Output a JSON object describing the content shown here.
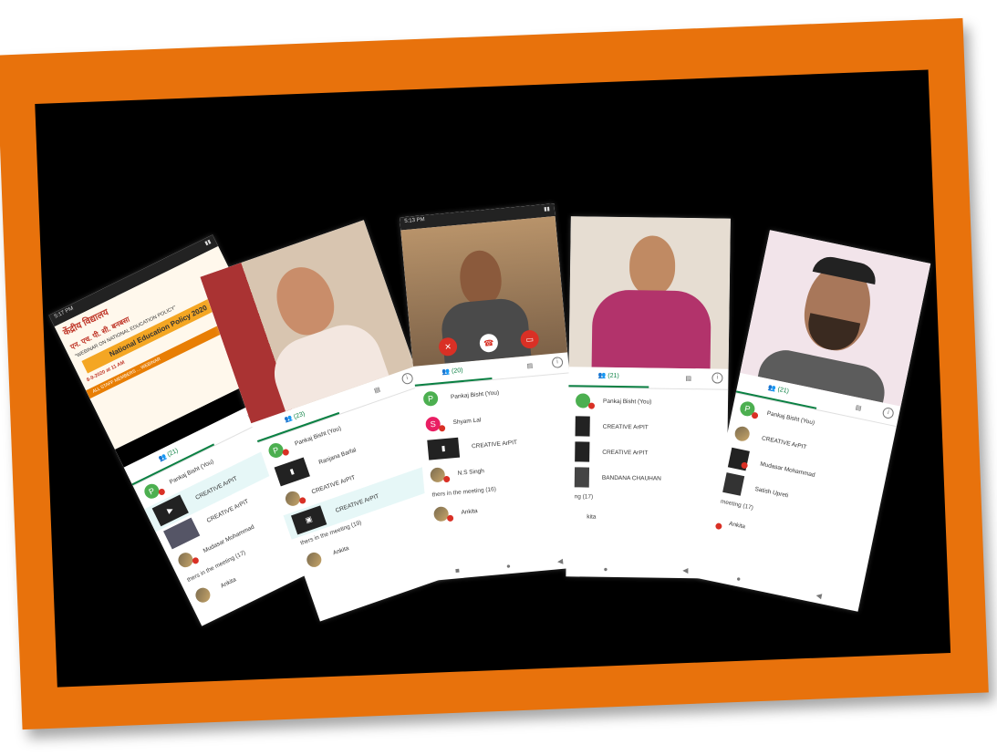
{
  "phones": [
    {
      "status_time": "5:17 PM",
      "poster": {
        "hindi_title": "केंद्रीय विद्यालय",
        "hindi_sub": "एन. एच. पी. सी. बनबसा",
        "subtitle": "\"WEBINAR ON NATIONAL EDUCATION POLICY\"",
        "banner": "National Education Policy 2020",
        "date": "8-9-2020 at 11 AM",
        "footer": "ALL STAFF MEMBERS ... WEBINAR"
      },
      "people_count": "(21)",
      "rows": [
        {
          "avatar": "P",
          "name": "Pankaj Bisht (You)"
        },
        {
          "avatar": "",
          "name": "CREATIVE ArPIT"
        },
        {
          "avatar": "",
          "name": "CREATIVE ArPIT"
        },
        {
          "avatar": "",
          "name": "Mudasar Mohammad"
        }
      ],
      "section": "thers in the meeting (17)",
      "last_row": "Ankita"
    },
    {
      "people_count": "(23)",
      "rows": [
        {
          "avatar": "P",
          "name": "Pankaj Bisht (You)"
        },
        {
          "avatar": "",
          "name": "Ranjana Barfal"
        },
        {
          "avatar": "",
          "name": "CREATIVE ArPIT"
        },
        {
          "avatar": "",
          "name": "CREATIVE ArPIT"
        }
      ],
      "section": "thers in the meeting (19)",
      "last_row": "Ankita"
    },
    {
      "status_time": "5:13 PM",
      "people_count": "(20)",
      "rows": [
        {
          "avatar": "P",
          "name": "Pankaj Bisht (You)"
        },
        {
          "avatar": "S",
          "name": "Shyam Lal"
        },
        {
          "avatar": "",
          "name": "CREATIVE ArPIT"
        },
        {
          "avatar": "",
          "name": "N.S Singh"
        }
      ],
      "section": "thers in the meeting (16)",
      "last_row": "Ankita"
    },
    {
      "people_count": "(21)",
      "rows": [
        {
          "avatar": "",
          "name": "Pankaj Bisht (You)"
        },
        {
          "avatar": "",
          "name": "CREATIVE ArPIT"
        },
        {
          "avatar": "",
          "name": "CREATIVE ArPIT"
        },
        {
          "avatar": "",
          "name": "BANDANA CHAUHAN"
        }
      ],
      "section": "ng (17)",
      "last_row": "kita"
    },
    {
      "people_count": "(21)",
      "rows": [
        {
          "avatar": "P",
          "name": "Pankaj Bisht (You)"
        },
        {
          "avatar": "",
          "name": "CREATIVE ArPIT"
        },
        {
          "avatar": "",
          "name": "Mudasar Mohammad"
        },
        {
          "avatar": "",
          "name": "Satish Upreti"
        }
      ],
      "section": "meeting (17)",
      "last_row": "Ankita"
    }
  ]
}
